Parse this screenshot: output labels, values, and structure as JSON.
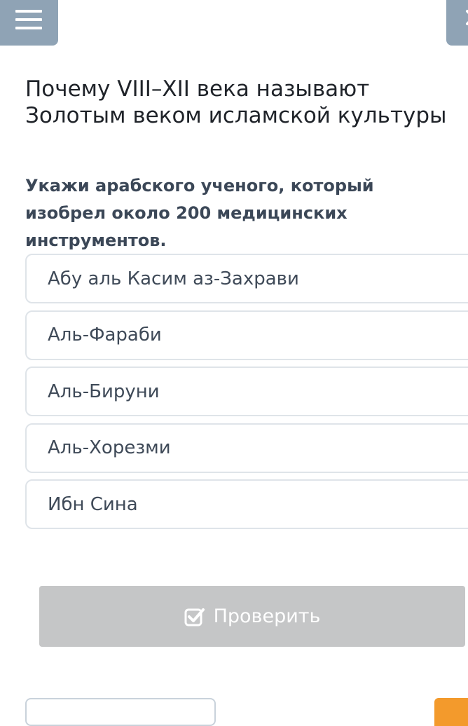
{
  "header": {
    "menu_icon": "hamburger-menu-icon",
    "close_icon": "close-icon"
  },
  "title": "Почему VIII–XII века называют\nЗолотым веком исламской культуры",
  "question": "Укажи арабского ученого, который\nизобрел около 200 медицинских\nинструментов.",
  "options": [
    {
      "label": "Абу аль Касим аз-Захрави"
    },
    {
      "label": "Аль-Фараби"
    },
    {
      "label": "Аль-Бируни"
    },
    {
      "label": "Аль-Хорезми"
    },
    {
      "label": "Ибн Сина"
    }
  ],
  "check_button": {
    "label": "Проверить",
    "icon": "checkbox-icon",
    "state": "disabled"
  },
  "colors": {
    "header_button": "#8fa3b5",
    "option_border": "#dfe4e9",
    "check_button_disabled": "#c5c6c7",
    "accent_orange": "#f39a2c"
  }
}
